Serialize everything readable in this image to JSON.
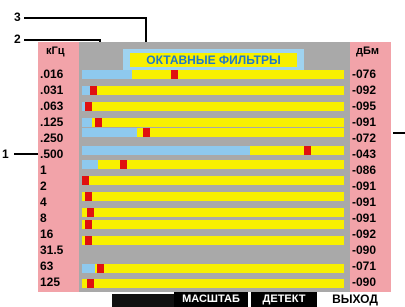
{
  "title": "ОКТАВНЫЕ ФИЛЬТРЫ",
  "left_unit": "кГц",
  "right_unit": "дБм",
  "callouts": [
    "3",
    "2",
    "1"
  ],
  "frequencies": [
    ".016",
    ".031",
    ".063",
    ".125",
    ".250",
    ".500",
    "1",
    "2",
    "4",
    "8",
    "16",
    "31.5",
    "63",
    "125"
  ],
  "levels": [
    "-076",
    "-092",
    "-095",
    "-091",
    "-072",
    "-043",
    "-086",
    "-091",
    "-091",
    "-091",
    "-092",
    "-090",
    "-071",
    "-090"
  ],
  "bars": [
    {
      "fill": 0.19,
      "marker": 0.35
    },
    {
      "fill": 0.03,
      "marker": 0.03
    },
    {
      "fill": 0.01,
      "marker": 0.01
    },
    {
      "fill": 0.04,
      "marker": 0.05
    },
    {
      "fill": 0.21,
      "marker": 0.24
    },
    {
      "fill": 0.64,
      "marker": 0.87
    },
    {
      "fill": 0.06,
      "marker": 0.15
    },
    {
      "fill": 0.0,
      "marker": 0.0
    },
    {
      "fill": 0.0,
      "marker": 0.01
    },
    {
      "fill": 0.0,
      "marker": 0.02
    },
    {
      "fill": 0.0,
      "marker": 0.01
    },
    {
      "fill": 0.0,
      "marker": 0.01
    },
    {
      "fill": 0.05,
      "marker": 0.06
    },
    {
      "fill": 0.0,
      "marker": 0.02
    }
  ],
  "softkeys": [
    "МАСШТАБ",
    "ДЕТЕКТ",
    "ВЫХОД"
  ],
  "colors": {
    "side_panel": "#f2a3a9",
    "bar_background": "#f8f000",
    "bar_fill": "#8ec9ee",
    "marker": "#e01010",
    "title_text": "#1f78c8"
  }
}
